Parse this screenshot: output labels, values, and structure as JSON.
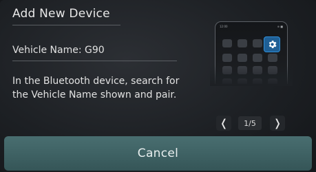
{
  "dialog": {
    "title": "Add New Device",
    "vehicle_name": "Vehicle Name: G90",
    "instructions": "In the Bluetooth device, search for the Vehicle Name shown and pair."
  },
  "illustration": {
    "status_time": "12:00",
    "status_right": "⊕ ■",
    "highlight_icon": "gear-icon",
    "highlight_color": "#2f8fd9"
  },
  "pager": {
    "prev_icon": "chevron-left-icon",
    "next_icon": "chevron-right-icon",
    "prev_label": "❬",
    "next_label": "❭",
    "page_indicator": "1/5"
  },
  "actions": {
    "cancel_label": "Cancel"
  },
  "colors": {
    "background": "#1d2024",
    "cancel_button": "#3e6163",
    "accent": "#2f8fd9"
  }
}
